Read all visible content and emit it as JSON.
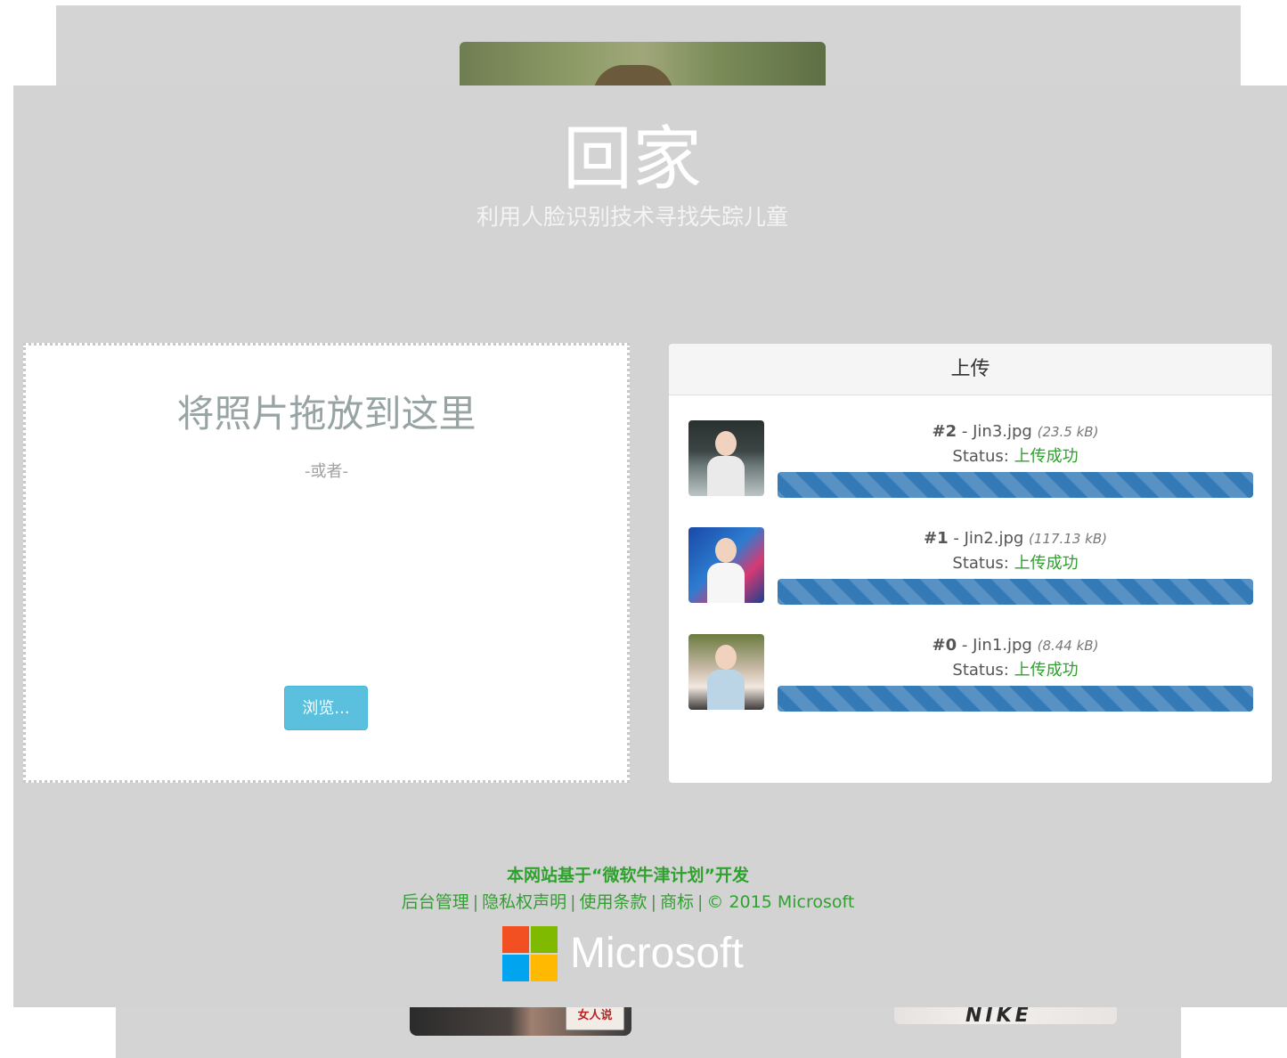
{
  "hero": {
    "title": "回家",
    "subtitle": "利用人脸识别技术寻找失踪儿童"
  },
  "dropzone": {
    "title": "将照片拖放到这里",
    "or_text": "-或者-",
    "browse_label": "浏览..."
  },
  "upload_panel": {
    "heading": "上传",
    "status_label": "Status:",
    "items": [
      {
        "num": "#2",
        "name": "Jin3.jpg",
        "size": "(23.5 kB)",
        "status": "上传成功",
        "progress_percent": 100
      },
      {
        "num": "#1",
        "name": "Jin2.jpg",
        "size": "(117.13 kB)",
        "status": "上传成功",
        "progress_percent": 100
      },
      {
        "num": "#0",
        "name": "Jin1.jpg",
        "size": "(8.44 kB)",
        "status": "上传成功",
        "progress_percent": 100
      }
    ]
  },
  "footer": {
    "line1": "本网站基于“微软牛津计划”开发",
    "links": [
      "后台管理",
      "隐私权声明",
      "使用条款",
      "商标"
    ],
    "copyright": "© 2015 Microsoft",
    "logo_text": "Microsoft"
  },
  "background_photos": {
    "badge_text": "女人说",
    "shirt_text": "NIKE"
  },
  "colors": {
    "accent_blue": "#337ab7",
    "success_green": "#2ea02e",
    "browse_button": "#5bc0de",
    "page_background": "#d3d3d3"
  }
}
